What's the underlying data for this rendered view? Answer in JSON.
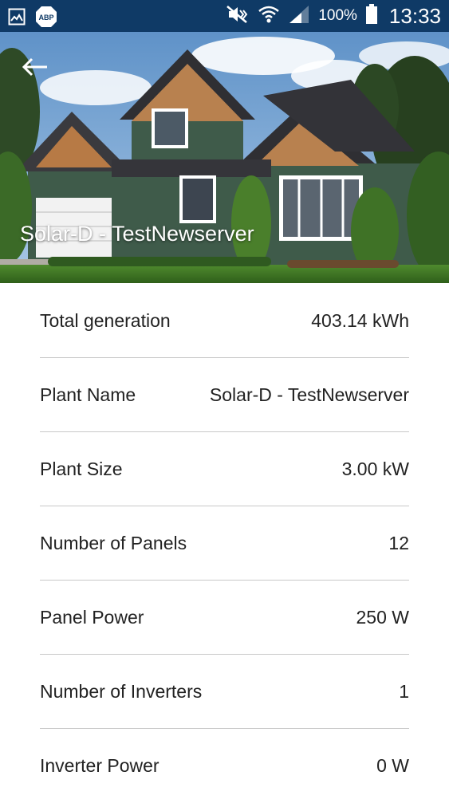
{
  "status_bar": {
    "left_icons": [
      "image-notification-icon",
      "adblock-icon"
    ],
    "adblock_label": "ABP",
    "battery_percent": "100%",
    "time": "13:33",
    "background_color": "#0f3a66"
  },
  "header": {
    "title": "Solar-D - TestNewserver",
    "back_icon": "arrow-left-icon"
  },
  "details": [
    {
      "label": "Total generation",
      "value": "403.14 kWh"
    },
    {
      "label": "Plant Name",
      "value": "Solar-D - TestNewserver"
    },
    {
      "label": "Plant Size",
      "value": "3.00 kW"
    },
    {
      "label": "Number of Panels",
      "value": "12"
    },
    {
      "label": "Panel Power",
      "value": "250 W"
    },
    {
      "label": "Number of Inverters",
      "value": "1"
    },
    {
      "label": "Inverter Power",
      "value": "0 W"
    }
  ]
}
